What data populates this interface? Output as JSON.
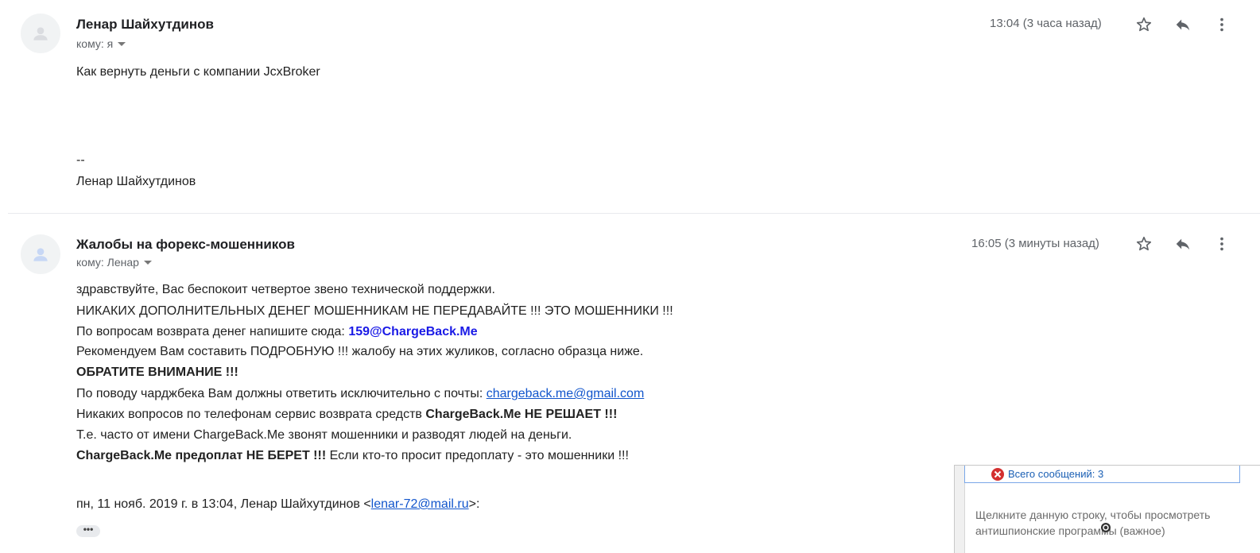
{
  "messages": [
    {
      "sender": "Ленар Шайхутдинов",
      "recipient": "кому: я",
      "time": "13:04 (3 часа назад)",
      "body": {
        "question": "Как вернуть деньги с компании    JcxBroker",
        "sig_sep": "--",
        "sig_name": "Ленар Шайхутдинов"
      }
    },
    {
      "sender": "Жалобы на форекс-мошенников",
      "recipient": "кому: Ленар",
      "time": "16:05 (3 минуты назад)",
      "body": {
        "l1": "здравствуйте, Вас беспокоит четвертое звено технической поддержки.",
        "l2": "НИКАКИХ ДОПОЛНИТЕЛЬНЫХ ДЕНЕГ МОШЕННИКАМ НЕ ПЕРЕДАВАЙТЕ !!! ЭТО МОШЕННИКИ !!!",
        "l3_pre": "По вопросам возврата денег напишите сюда: ",
        "l3_email": "159@ChargeBack.Me",
        "l4": "Рекомендуем Вам составить ПОДРОБНУЮ !!! жалобу на этих жуликов, согласно образца ниже.",
        "l5": "ОБРАТИТЕ ВНИМАНИЕ !!!",
        "l6_pre": "По поводу чарджбека Вам должны ответить исключительно с почты: ",
        "l6_link": "chargeback.me@gmail.com",
        "l7_pre": "Никаких вопросов по телефонам сервис возврата средств ",
        "l7_bold": "ChargeBack.Me НЕ РЕШАЕТ !!!",
        "l8": "Т.е. часто от имени ChargeBack.Me звонят мошенники и разводят людей на деньги.",
        "l9_bold": "ChargeBack.Me предоплат НЕ БЕРЕТ !!!",
        "l9_rest": " Если кто-то просит предоплату - это мошенники !!!",
        "quote_pre": "пн, 11 нояб. 2019 г. в 13:04, Ленар Шайхутдинов <",
        "quote_link": "lenar-72@mail.ru",
        "quote_post": ">:",
        "ellipsis": "•••"
      }
    }
  ],
  "popup": {
    "head_label": "Всего сообщений: 3",
    "text": "Щелкните данную строку, чтобы просмотреть антишпионские программы (важное)"
  },
  "icons": [
    "avatar-icon",
    "star-icon",
    "reply-icon",
    "more-vert-icon",
    "caret-down-icon",
    "error-icon",
    "cursor-icon"
  ],
  "colors": {
    "link": "#1155cc",
    "email_highlight": "#1a1ae6",
    "error": "#d32f2f"
  }
}
